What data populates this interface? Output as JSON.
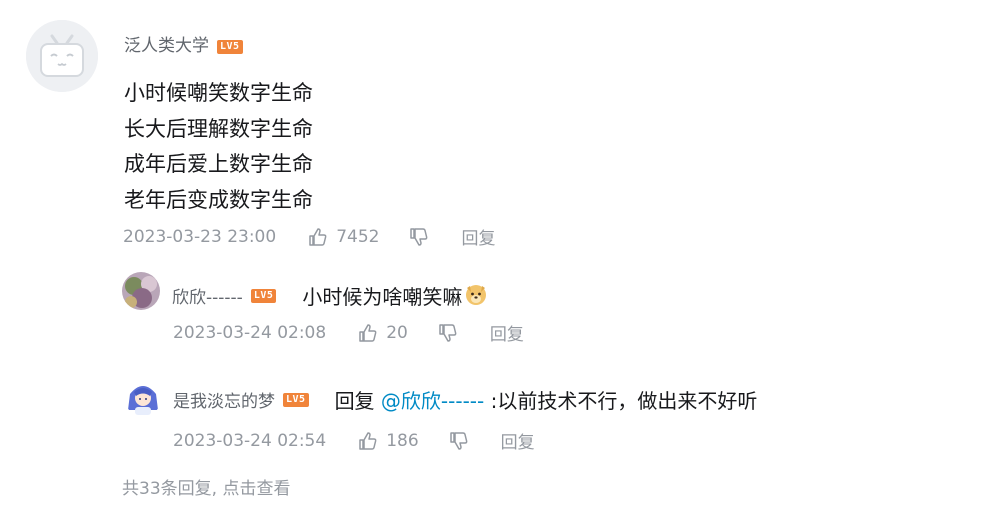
{
  "main_comment": {
    "username": "泛人类大学",
    "level_badge": "LV5",
    "lines": [
      "小时候嘲笑数字生命",
      "长大后理解数字生命",
      "成年后爱上数字生命",
      "老年后变成数字生命"
    ],
    "timestamp": "2023-03-23 23:00",
    "likes": "7452",
    "reply_label": "回复"
  },
  "replies": [
    {
      "username": "欣欣------",
      "level_badge": "LV5",
      "text": "小时候为啥嘲笑嘛",
      "emoji": "doge-emoji",
      "timestamp": "2023-03-24 02:08",
      "likes": "20",
      "reply_label": "回复"
    },
    {
      "username": "是我淡忘的梦",
      "level_badge": "LV5",
      "reply_prefix": "回复 ",
      "mention": "@欣欣------",
      "text": " :以前技术不行，做出来不好听",
      "timestamp": "2023-03-24 02:54",
      "likes": "186",
      "reply_label": "回复"
    }
  ],
  "footer": {
    "more_replies": "共33条回复, 点击查看"
  },
  "colors": {
    "meta": "#9499a0",
    "mention": "#008ac5",
    "badge": "#f0843a",
    "text": "#18191c"
  }
}
